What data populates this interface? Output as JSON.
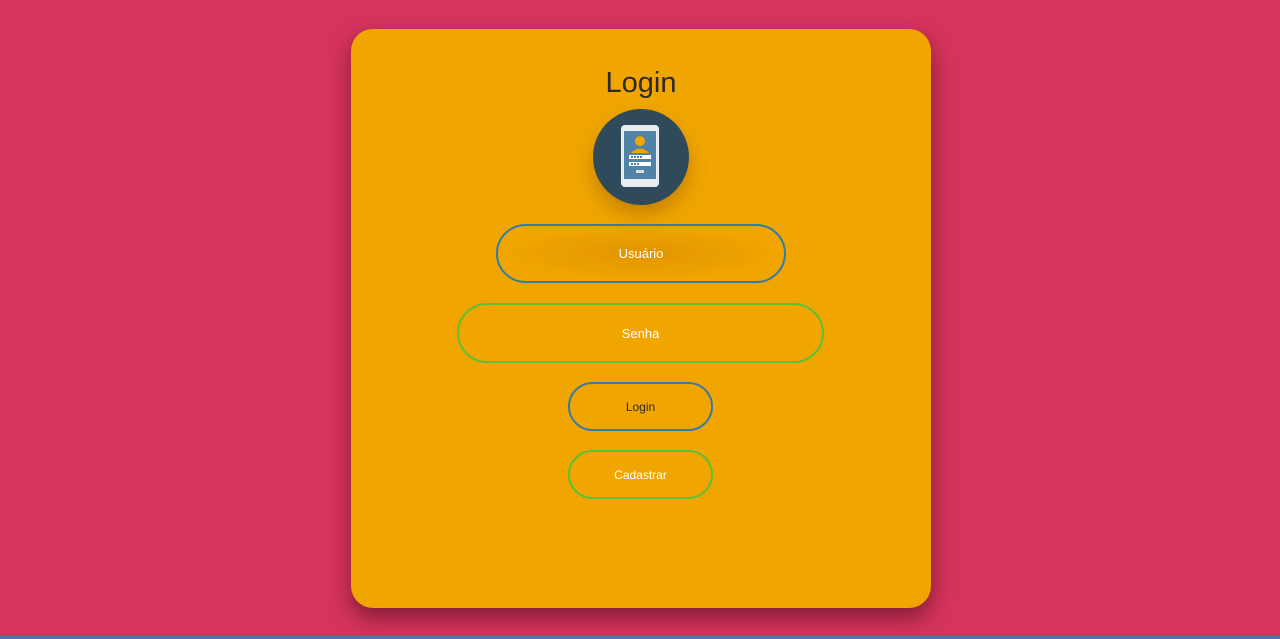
{
  "login_card": {
    "title": "Login",
    "avatar_icon": "mobile-login-icon",
    "username": {
      "placeholder": "Usuário",
      "value": ""
    },
    "password": {
      "placeholder": "Senha",
      "value": ""
    },
    "login_button": "Login",
    "register_button": "Cadastrar"
  },
  "colors": {
    "background": "#d6345d",
    "card": "#f0a500",
    "avatar_bg": "#2f4a5a",
    "username_border": "#2e7ea6",
    "password_border": "#5cbf3a",
    "login_border": "#3a7aa0",
    "register_border": "#5cbf3a"
  }
}
